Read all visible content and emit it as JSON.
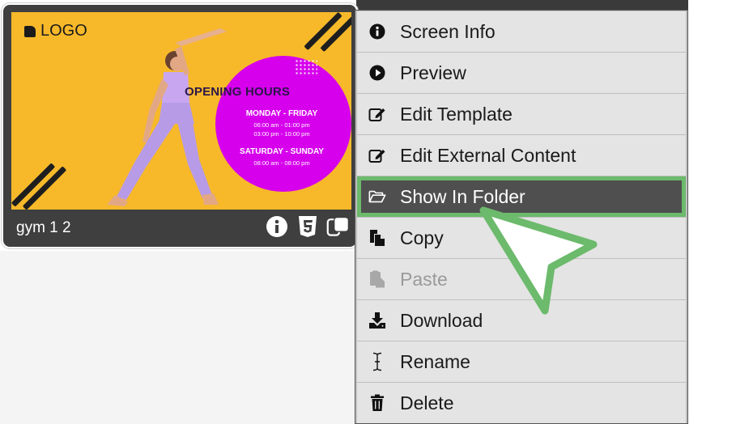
{
  "card": {
    "title": "gym 1 2",
    "thumbnail": {
      "logo_text": "LOGO",
      "heading": "OPENING HOURS",
      "weekday_label": "MONDAY - FRIDAY",
      "weekday_time_1": "06:00 am - 01:00 pm",
      "weekday_time_2": "03:00 pm - 10:00 pm",
      "weekend_label": "SATURDAY - SUNDAY",
      "weekend_time_1": "08:00 am - 08:00 pm"
    },
    "icons": [
      "info-icon",
      "html5-icon",
      "duplicate-icon"
    ]
  },
  "context_menu": {
    "items": [
      {
        "label": "Screen Info",
        "icon": "info-circle-icon",
        "state": "normal"
      },
      {
        "label": "Preview",
        "icon": "play-circle-icon",
        "state": "normal"
      },
      {
        "label": "Edit Template",
        "icon": "edit-icon",
        "state": "normal"
      },
      {
        "label": "Edit External Content",
        "icon": "edit-icon",
        "state": "normal"
      },
      {
        "label": "Show In Folder",
        "icon": "folder-open-icon",
        "state": "highlighted"
      },
      {
        "label": "Copy",
        "icon": "copy-icon",
        "state": "normal"
      },
      {
        "label": "Paste",
        "icon": "paste-icon",
        "state": "disabled"
      },
      {
        "label": "Download",
        "icon": "download-icon",
        "state": "normal"
      },
      {
        "label": "Rename",
        "icon": "text-cursor-icon",
        "state": "normal"
      },
      {
        "label": "Delete",
        "icon": "trash-icon",
        "state": "normal"
      }
    ]
  },
  "colors": {
    "highlight_border": "#6cba6c",
    "thumbnail_bg": "#f7b92a",
    "circle": "#d600ec",
    "menu_item_bg": "#e4e4e4",
    "menu_item_active_bg": "#4f4f4f"
  }
}
